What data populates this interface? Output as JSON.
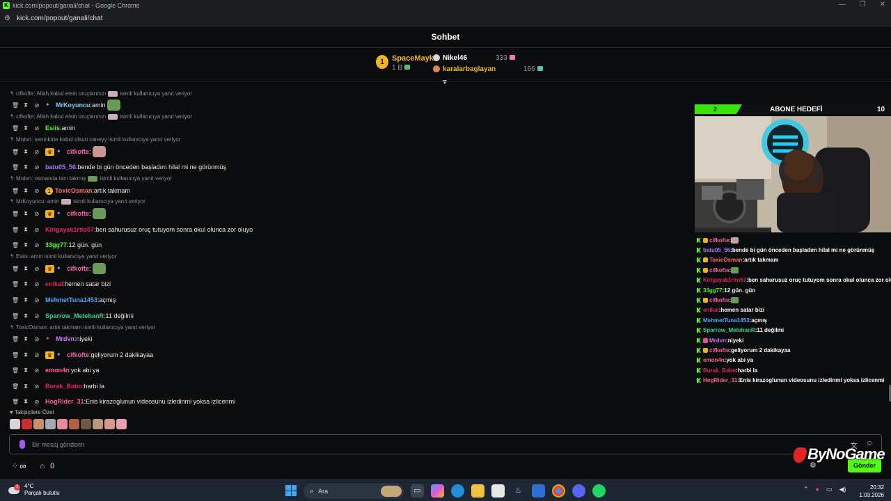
{
  "window": {
    "title": "kick.com/popout/ganali/chat - Google Chrome",
    "url": "kick.com/popout/ganali/chat"
  },
  "header": {
    "title": "Sohbet"
  },
  "leaderboard": {
    "first": {
      "rank": "1",
      "name": "SpaceMayk",
      "amount": "1 B"
    },
    "second": {
      "name": "Nikel46",
      "amount": "333"
    },
    "third": {
      "name": "karalarbaglayan",
      "amount": "166"
    }
  },
  "chat": [
    {
      "reply": "cifkofte: Allah kabul etsin oruçlarınızı",
      "reply_suffix": "isimli kullanıcıya yanıt veriyor",
      "user": "MrKoyuncu",
      "color": "#7ec8ff",
      "text": "amin"
    },
    {
      "reply": "cifkofte: Allah kabul etsin oruçlarınızı",
      "reply_suffix": "isimli kullanıcıya yanıt veriyor",
      "user": "Esiis",
      "color": "#53fc18",
      "text": "amin"
    },
    {
      "reply": "Mrdvn: seninkide kabul olsun caneyy isimli kullanıcıya yanıt veriyor",
      "reply_suffix": "",
      "user": "cifkofte",
      "color": "#ff5fa8",
      "text": ""
    },
    {
      "reply": "",
      "user": "batu05_56",
      "color": "#a970ff",
      "text": "bende bi gün önceden başladım hilal mi ne görünmüş"
    },
    {
      "reply": "Mrdvn: osmanda tacı takmış",
      "reply_suffix": "isimli kullanıcıya yanıt veriyor",
      "user": "ToxicOsman",
      "color": "#ff6b6b",
      "text": "artık takmam"
    },
    {
      "reply": "MrKoyuncu: amin",
      "reply_suffix": "isimli kullanıcıya yanıt veriyor",
      "user": "cifkofte",
      "color": "#ff5fa8",
      "text": ""
    },
    {
      "reply": "",
      "user": "Kirigayak1rito57",
      "color": "#e0245e",
      "text": "ben sahurusuz oruç tutuyom sonra okul olunca zor oluyo"
    },
    {
      "reply": "",
      "user": "33gg77",
      "color": "#53fc18",
      "text": "12 gün. gün"
    },
    {
      "reply": "Esiis: amin isimli kullanıcıya yanıt veriyor",
      "reply_suffix": "",
      "user": "cifkofte",
      "color": "#ff5fa8",
      "text": ""
    },
    {
      "reply": "",
      "user": "enikal",
      "color": "#e0245e",
      "text": "hemen satar bizi"
    },
    {
      "reply": "",
      "user": "MehmetTuna1453",
      "color": "#4fa3ff",
      "text": "açmış"
    },
    {
      "reply": "",
      "user": "Sparrow_MetehanR",
      "color": "#2fd39b",
      "text": "11 değilmi"
    },
    {
      "reply": "ToxicOsman: artık takmam isimli kullanıcıya yanıt veriyor",
      "reply_suffix": "",
      "user": "Mrdvn",
      "color": "#c47dff",
      "text": "niyeki"
    },
    {
      "reply": "",
      "user": "cifkofte",
      "color": "#ff5fa8",
      "text": "geliyorum 2 dakikayaa"
    },
    {
      "reply": "",
      "user": "emon4n",
      "color": "#ff5f8f",
      "text": "yok abi ya"
    },
    {
      "reply": "",
      "user": "Burak_Babo",
      "color": "#e0245e",
      "text": "harbi la"
    },
    {
      "reply": "",
      "user": "HogRider_31",
      "color": "#ff5f8f",
      "text": "Enis kirazoglunun videosunu izledinmi yoksa izlicenmi"
    }
  ],
  "follower_emotes": {
    "label": "Takipçilere Özel"
  },
  "input": {
    "placeholder": "Bir mesaj gönderin"
  },
  "bottom": {
    "infinity": "∞",
    "store_count": "0",
    "send_label": "Gönder"
  },
  "overlay": {
    "goal": {
      "current": "2",
      "title": "ABONE HEDEFİ",
      "target": "10"
    },
    "chat": [
      {
        "user": "cifkofte",
        "color": "#ff5fa8",
        "text": ""
      },
      {
        "user": "batu05_56",
        "color": "#a970ff",
        "text": "bende bi gün önceden başladım hilal mi ne görünmüş"
      },
      {
        "user": "ToxicOsman",
        "color": "#ff6b6b",
        "text": "artık takmam"
      },
      {
        "user": "cifkofte",
        "color": "#ff5fa8",
        "text": ""
      },
      {
        "user": "Kirigayak1rito57",
        "color": "#e0245e",
        "text": "ben sahurusuz oruç tutuyom sonra okul olunca zor oluyo"
      },
      {
        "user": "33gg77",
        "color": "#53fc18",
        "text": "12 gün. gün"
      },
      {
        "user": "cifkofte",
        "color": "#ff5fa8",
        "text": ""
      },
      {
        "user": "enikal",
        "color": "#e0245e",
        "text": "hemen satar bizi"
      },
      {
        "user": "MehmetTuna1453",
        "color": "#4fa3ff",
        "text": "açmış"
      },
      {
        "user": "Sparrow_MetehanR",
        "color": "#2fd39b",
        "text": "11 değilmi"
      },
      {
        "user": "Mrdvn",
        "color": "#c47dff",
        "text": "niyeki"
      },
      {
        "user": "cifkofte",
        "color": "#ff5fa8",
        "text": "geliyorum 2 dakikayaa"
      },
      {
        "user": "emon4n",
        "color": "#ff5f8f",
        "text": "yok abi ya"
      },
      {
        "user": "Burak_Babo",
        "color": "#e0245e",
        "text": "harbi la"
      },
      {
        "user": "HogRider_31",
        "color": "#ff5f8f",
        "text": "Enis kirazoglunun videosunu izledinmi yoksa izlicenmi"
      }
    ],
    "logo": "ByNoGame"
  },
  "taskbar": {
    "weather_temp": "4°C",
    "weather_desc": "Parçalı bulutlu",
    "weather_badge": "2",
    "search_label": "Ara",
    "time": "20:32",
    "date": "1.03.2026"
  }
}
